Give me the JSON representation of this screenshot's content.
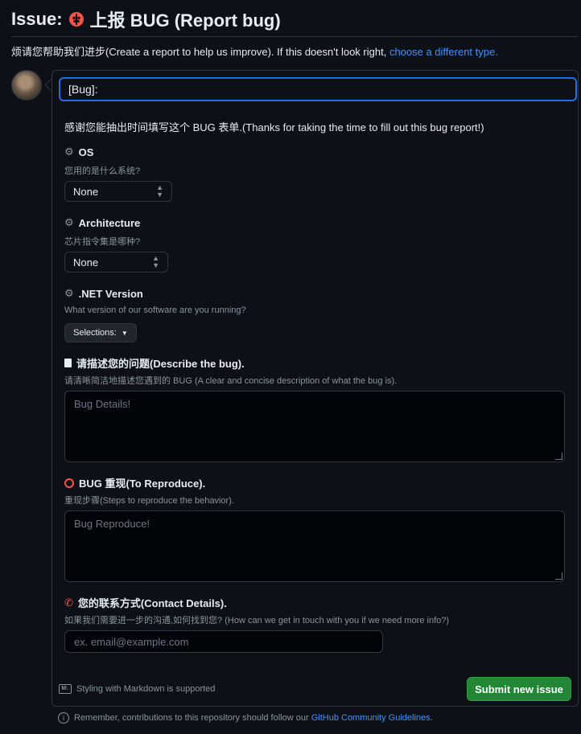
{
  "header": {
    "issue_label": "Issue:",
    "title": "上报 BUG (Report bug)"
  },
  "intro": {
    "text": "烦请您帮助我们进步(Create a report to help us improve). If this doesn't look right, ",
    "link": "choose a different type."
  },
  "form": {
    "title_value": "[Bug]:",
    "thanks": "感谢您能抽出时间填写这个 BUG 表单.(Thanks for taking the time to fill out this bug report!)",
    "os": {
      "label": "OS",
      "help": "您用的是什么系统?",
      "value": "None"
    },
    "arch": {
      "label": "Architecture",
      "help": "芯片指令集是哪种?",
      "value": "None"
    },
    "dotnet": {
      "label": ".NET Version",
      "help": "What version of our software are you running?",
      "button": "Selections:"
    },
    "describe": {
      "label": "请描述您的问题(Describe the bug).",
      "help": "请清晰简洁地描述您遇到的 BUG (A clear and concise description of what the bug is).",
      "placeholder": "Bug Details!"
    },
    "reproduce": {
      "label": "BUG 重现(To Reproduce).",
      "help": "重现步骤(Steps to reproduce the behavior).",
      "placeholder": "Bug Reproduce!"
    },
    "contact": {
      "label": "您的联系方式(Contact Details).",
      "help": "如果我们需要进一步的沟通,如何找到您? (How can we get in touch with you if we need more info?)",
      "placeholder": "ex. email@example.com"
    },
    "markdown_note": "Styling with Markdown is supported",
    "markdown_badge": "M↓",
    "submit_label": "Submit new issue"
  },
  "footer": {
    "text": "Remember, contributions to this repository should follow our ",
    "link": "GitHub Community Guidelines",
    "end": "."
  },
  "colors": {
    "accent": "#4493f8",
    "submit": "#238636",
    "danger": "#f85149"
  },
  "icons": {
    "issue": "ladybug-icon",
    "os": "gear-icon",
    "arch": "gear-icon",
    "dotnet": "gear-icon",
    "describe": "document-icon",
    "reproduce": "ring-icon",
    "contact": "phone-icon",
    "markdown": "markdown-icon",
    "info": "info-icon"
  }
}
